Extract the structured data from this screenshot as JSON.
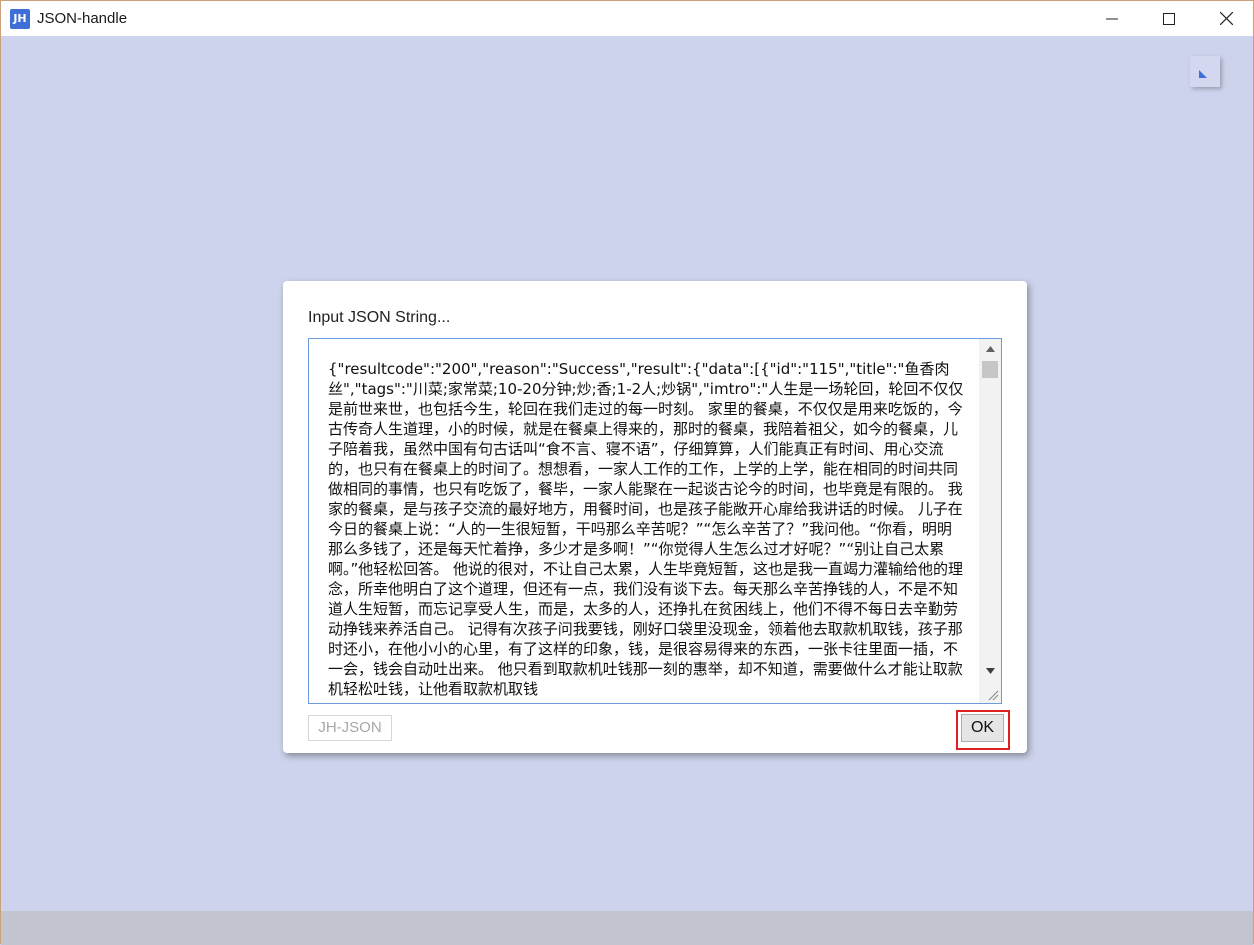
{
  "window": {
    "title": "JSON-handle",
    "app_icon_text": "JH",
    "minimize_icon": "minimize-icon",
    "maximize_icon": "maximize-icon",
    "close_icon": "close-icon"
  },
  "corner_button": {
    "icon": "triangle-corner-icon"
  },
  "dialog": {
    "label": "Input JSON String...",
    "input_value": "{\"resultcode\":\"200\",\"reason\":\"Success\",\"result\":{\"data\":[{\"id\":\"115\",\"title\":\"鱼香肉丝\",\"tags\":\"川菜;家常菜;10-20分钟;炒;香;1-2人;炒锅\",\"imtro\":\"人生是一场轮回，轮回不仅仅是前世来世，也包括今生，轮回在我们走过的每一时刻。 家里的餐桌，不仅仅是用来吃饭的，今古传奇人生道理，小的时候，就是在餐桌上得来的，那时的餐桌，我陪着祖父，如今的餐桌，儿子陪着我，虽然中国有句古话叫“食不言、寝不语”，仔细算算，人们能真正有时间、用心交流的，也只有在餐桌上的时间了。想想看，一家人工作的工作，上学的上学，能在相同的时间共同做相同的事情，也只有吃饭了，餐毕，一家人能聚在一起谈古论今的时间，也毕竟是有限的。 我家的餐桌，是与孩子交流的最好地方，用餐时间，也是孩子能敞开心扉给我讲话的时候。 儿子在今日的餐桌上说：“人的一生很短暂，干吗那么辛苦呢？”“怎么辛苦了？”我问他。“你看，明明那么多钱了，还是每天忙着挣，多少才是多啊！”“你觉得人生怎么过才好呢？”“别让自己太累啊。”他轻松回答。 他说的很对，不让自己太累，人生毕竟短暂，这也是我一直竭力灌输给他的理念，所幸他明白了这个道理，但还有一点，我们没有谈下去。每天那么辛苦挣钱的人，不是不知道人生短暂，而忘记享受人生，而是，太多的人，还挣扎在贫困线上，他们不得不每日去辛勤劳动挣钱来养活自己。 记得有次孩子问我要钱，刚好口袋里没现金，领着他去取款机取钱，孩子那时还小，在他小小的心里，有了这样的印象，钱，是很容易得来的东西，一张卡往里面一插，不一会，钱会自动吐出来。 他只看到取款机吐钱那一刻的惠举，却不知道，需要做什么才能让取款机轻松吐钱，让他看取款机取钱",
    "jh_button": "JH-JSON",
    "ok_button": "OK"
  },
  "colors": {
    "background": "#cdd3ec",
    "input_border": "#6b9cdc",
    "highlight_outline": "#e02020",
    "app_icon": "#3d6fd6"
  }
}
